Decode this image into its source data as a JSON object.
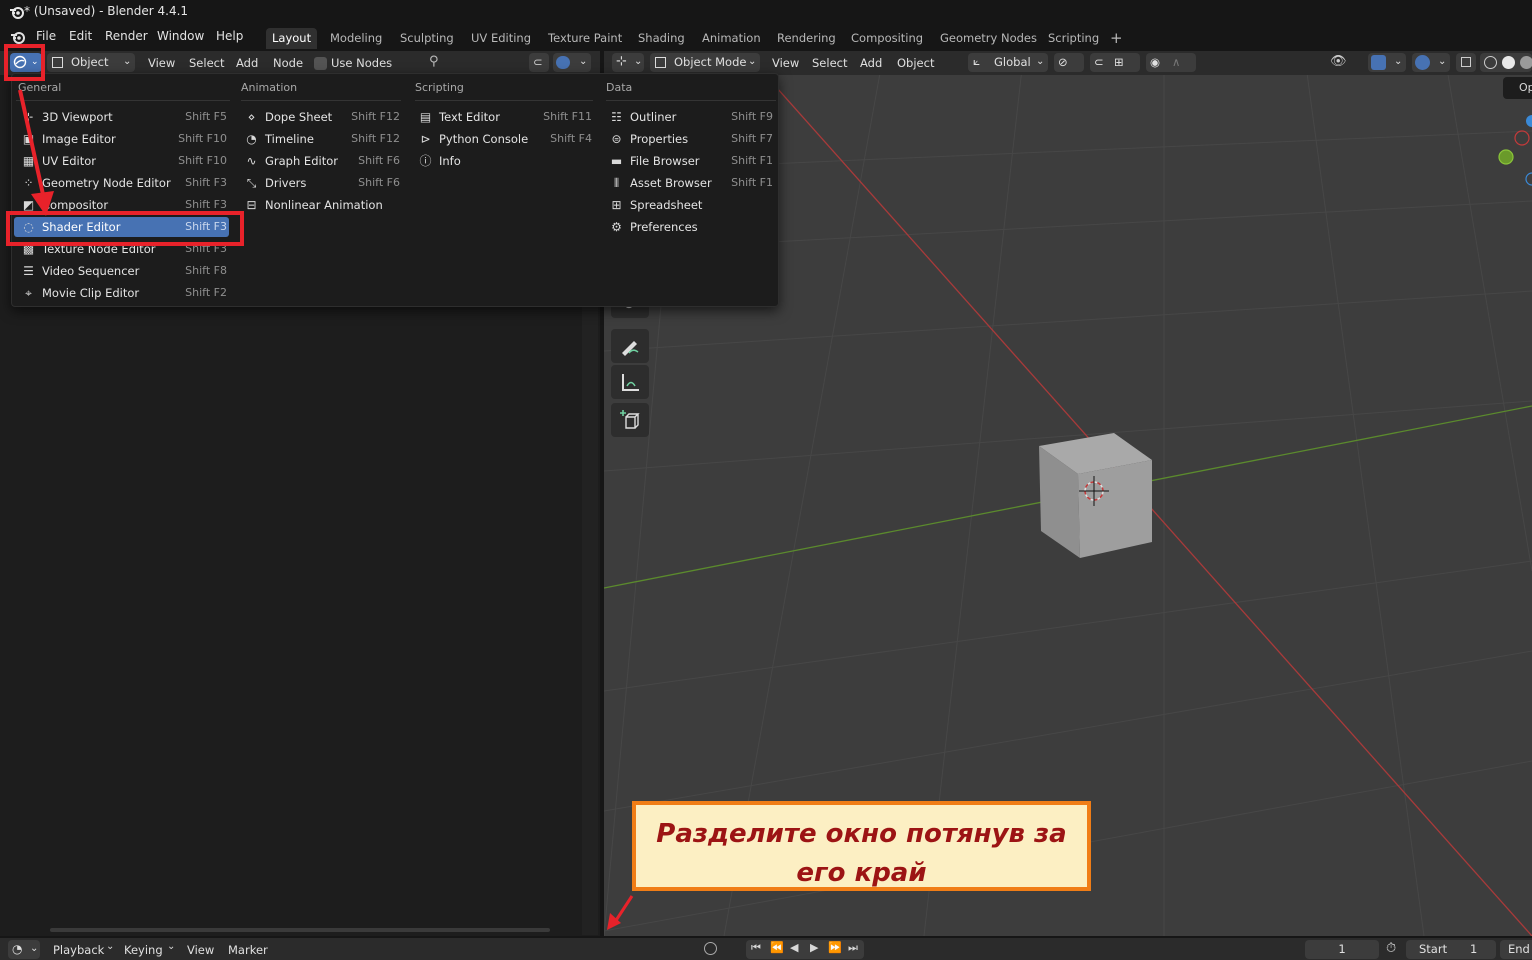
{
  "window": {
    "title": "* (Unsaved) - Blender 4.4.1"
  },
  "menu": [
    "File",
    "Edit",
    "Render",
    "Window",
    "Help"
  ],
  "workspaces": {
    "active": "Layout",
    "tabs": [
      "Layout",
      "Modeling",
      "Sculpting",
      "UV Editing",
      "Texture Paint",
      "Shading",
      "Animation",
      "Rendering",
      "Compositing",
      "Geometry Nodes",
      "Scripting"
    ],
    "add": "+"
  },
  "node_header": {
    "object_dropdown": "Object",
    "menus": [
      "View",
      "Select",
      "Add",
      "Node"
    ],
    "use_nodes": "Use Nodes"
  },
  "viewport_header": {
    "mode": "Object Mode",
    "menus": [
      "View",
      "Select",
      "Add",
      "Object"
    ],
    "orientation": "Global",
    "options_cut": "Op"
  },
  "editor_menu": {
    "columns": [
      {
        "heading": "General",
        "items": [
          {
            "label": "3D Viewport",
            "shortcut": "Shift F5",
            "icon": "viewport-icon"
          },
          {
            "label": "Image Editor",
            "shortcut": "Shift F10",
            "icon": "image-icon"
          },
          {
            "label": "UV Editor",
            "shortcut": "Shift F10",
            "icon": "uv-icon"
          },
          {
            "label": "Geometry Node Editor",
            "shortcut": "Shift F3",
            "icon": "geometry-nodes-icon"
          },
          {
            "label": "Compositor",
            "shortcut": "Shift F3",
            "icon": "compositor-icon"
          },
          {
            "label": "Shader Editor",
            "shortcut": "Shift F3",
            "icon": "shader-icon",
            "selected": true
          },
          {
            "label": "Texture Node Editor",
            "shortcut": "Shift F3",
            "icon": "texture-icon"
          },
          {
            "label": "Video Sequencer",
            "shortcut": "Shift F8",
            "icon": "sequencer-icon"
          },
          {
            "label": "Movie Clip Editor",
            "shortcut": "Shift F2",
            "icon": "clip-icon"
          }
        ]
      },
      {
        "heading": "Animation",
        "items": [
          {
            "label": "Dope Sheet",
            "shortcut": "Shift F12",
            "icon": "dopesheet-icon"
          },
          {
            "label": "Timeline",
            "shortcut": "Shift F12",
            "icon": "timeline-icon"
          },
          {
            "label": "Graph Editor",
            "shortcut": "Shift F6",
            "icon": "graph-icon"
          },
          {
            "label": "Drivers",
            "shortcut": "Shift F6",
            "icon": "drivers-icon"
          },
          {
            "label": "Nonlinear Animation",
            "shortcut": "",
            "icon": "nla-icon"
          }
        ]
      },
      {
        "heading": "Scripting",
        "items": [
          {
            "label": "Text Editor",
            "shortcut": "Shift F11",
            "icon": "text-icon"
          },
          {
            "label": "Python Console",
            "shortcut": "Shift F4",
            "icon": "console-icon"
          },
          {
            "label": "Info",
            "shortcut": "",
            "icon": "info-icon"
          }
        ]
      },
      {
        "heading": "Data",
        "items": [
          {
            "label": "Outliner",
            "shortcut": "Shift F9",
            "icon": "outliner-icon"
          },
          {
            "label": "Properties",
            "shortcut": "Shift F7",
            "icon": "properties-icon"
          },
          {
            "label": "File Browser",
            "shortcut": "Shift F1",
            "icon": "filebrowser-icon"
          },
          {
            "label": "Asset Browser",
            "shortcut": "Shift F1",
            "icon": "asset-icon"
          },
          {
            "label": "Spreadsheet",
            "shortcut": "",
            "icon": "spreadsheet-icon"
          },
          {
            "label": "Preferences",
            "shortcut": "",
            "icon": "gear-icon"
          }
        ]
      }
    ]
  },
  "timeline": {
    "menus": [
      "Playback",
      "Keying",
      "View",
      "Marker"
    ],
    "current_frame": "1",
    "start_label": "Start",
    "start_value": "1",
    "end_label": "End"
  },
  "annotation": {
    "line1": "Разделите окно потянув за",
    "line2": "его край",
    "highlight_color": "#e8222a",
    "note_border": "#f07d16"
  }
}
